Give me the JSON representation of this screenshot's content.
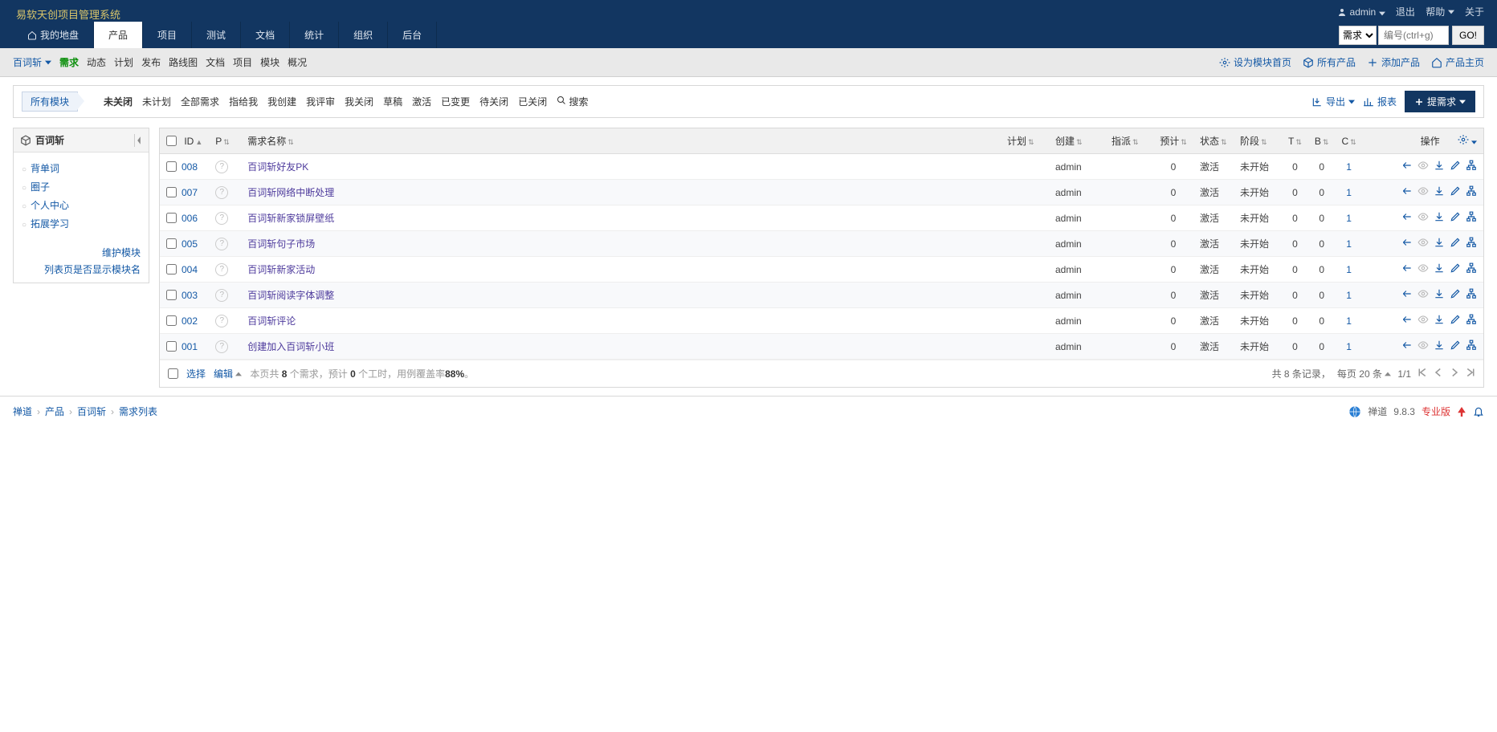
{
  "app": {
    "title": "易软天创项目管理系统"
  },
  "user": {
    "name": "admin",
    "logout": "退出",
    "help": "帮助",
    "about": "关于"
  },
  "search": {
    "type_label": "需求",
    "placeholder": "编号(ctrl+g)",
    "go": "GO!"
  },
  "mainnav": [
    {
      "key": "dashboard",
      "label": "我的地盘",
      "icon": "home"
    },
    {
      "key": "product",
      "label": "产品",
      "active": true
    },
    {
      "key": "project",
      "label": "项目"
    },
    {
      "key": "test",
      "label": "测试"
    },
    {
      "key": "doc",
      "label": "文档"
    },
    {
      "key": "stat",
      "label": "统计"
    },
    {
      "key": "org",
      "label": "组织"
    },
    {
      "key": "admin",
      "label": "后台"
    }
  ],
  "subnav": {
    "product_name": "百词斩",
    "items": [
      "需求",
      "动态",
      "计划",
      "发布",
      "路线图",
      "文档",
      "项目",
      "模块",
      "概况"
    ],
    "active": "需求",
    "right": {
      "set_home": "设为模块首页",
      "all_products": "所有产品",
      "add_product": "添加产品",
      "product_home": "产品主页"
    }
  },
  "filters": {
    "all_modules": "所有模块",
    "items": [
      "未关闭",
      "未计划",
      "全部需求",
      "指给我",
      "我创建",
      "我评审",
      "我关闭",
      "草稿",
      "激活",
      "已变更",
      "待关闭",
      "已关闭"
    ],
    "active": "未关闭",
    "search": "搜索",
    "export": "导出",
    "report": "报表",
    "create": "提需求"
  },
  "tree": {
    "title": "百词斩",
    "items": [
      "背单词",
      "圈子",
      "个人中心",
      "拓展学习"
    ],
    "maintain": "维护模块",
    "toggle_show": "列表页是否显示模块名"
  },
  "table": {
    "cols": {
      "id": "ID",
      "p": "P",
      "name": "需求名称",
      "plan": "计划",
      "creator": "创建",
      "assigned": "指派",
      "estimate": "预计",
      "status": "状态",
      "stage": "阶段",
      "t": "T",
      "b": "B",
      "c": "C",
      "actions": "操作"
    },
    "rows": [
      {
        "id": "008",
        "name": "百词斩好友PK",
        "creator": "admin",
        "estimate": "0",
        "status": "激活",
        "stage": "未开始",
        "t": "0",
        "b": "0",
        "c": "1"
      },
      {
        "id": "007",
        "name": "百词斩网络中断处理",
        "creator": "admin",
        "estimate": "0",
        "status": "激活",
        "stage": "未开始",
        "t": "0",
        "b": "0",
        "c": "1"
      },
      {
        "id": "006",
        "name": "百词斩新家锁屏壁纸",
        "creator": "admin",
        "estimate": "0",
        "status": "激活",
        "stage": "未开始",
        "t": "0",
        "b": "0",
        "c": "1"
      },
      {
        "id": "005",
        "name": "百词斩句子市场",
        "creator": "admin",
        "estimate": "0",
        "status": "激活",
        "stage": "未开始",
        "t": "0",
        "b": "0",
        "c": "1"
      },
      {
        "id": "004",
        "name": "百词斩新家活动",
        "creator": "admin",
        "estimate": "0",
        "status": "激活",
        "stage": "未开始",
        "t": "0",
        "b": "0",
        "c": "1"
      },
      {
        "id": "003",
        "name": "百词斩阅读字体调整",
        "creator": "admin",
        "estimate": "0",
        "status": "激活",
        "stage": "未开始",
        "t": "0",
        "b": "0",
        "c": "1"
      },
      {
        "id": "002",
        "name": "百词斩评论",
        "creator": "admin",
        "estimate": "0",
        "status": "激活",
        "stage": "未开始",
        "t": "0",
        "b": "0",
        "c": "1"
      },
      {
        "id": "001",
        "name": "创建加入百词斩小班",
        "creator": "admin",
        "estimate": "0",
        "status": "激活",
        "stage": "未开始",
        "t": "0",
        "b": "0",
        "c": "1"
      }
    ],
    "footer": {
      "select": "选择",
      "edit": "编辑",
      "summary_pre": "本页共 ",
      "summary_count": "8",
      "summary_mid1": " 个需求，预计 ",
      "summary_hours": "0",
      "summary_mid2": " 个工时，用例覆盖率",
      "summary_rate": "88%",
      "summary_end": "。",
      "page_info": "共 8 条记录，",
      "per_page_pre": "每页 ",
      "per_page": "20",
      "per_page_post": " 条",
      "page_pos": "1/1"
    }
  },
  "breadcrumb": {
    "items": [
      "禅道",
      "产品",
      "百词斩",
      "需求列表"
    ]
  },
  "footer_right": {
    "brand": "禅道",
    "version": "9.8.3",
    "edition": "专业版"
  }
}
